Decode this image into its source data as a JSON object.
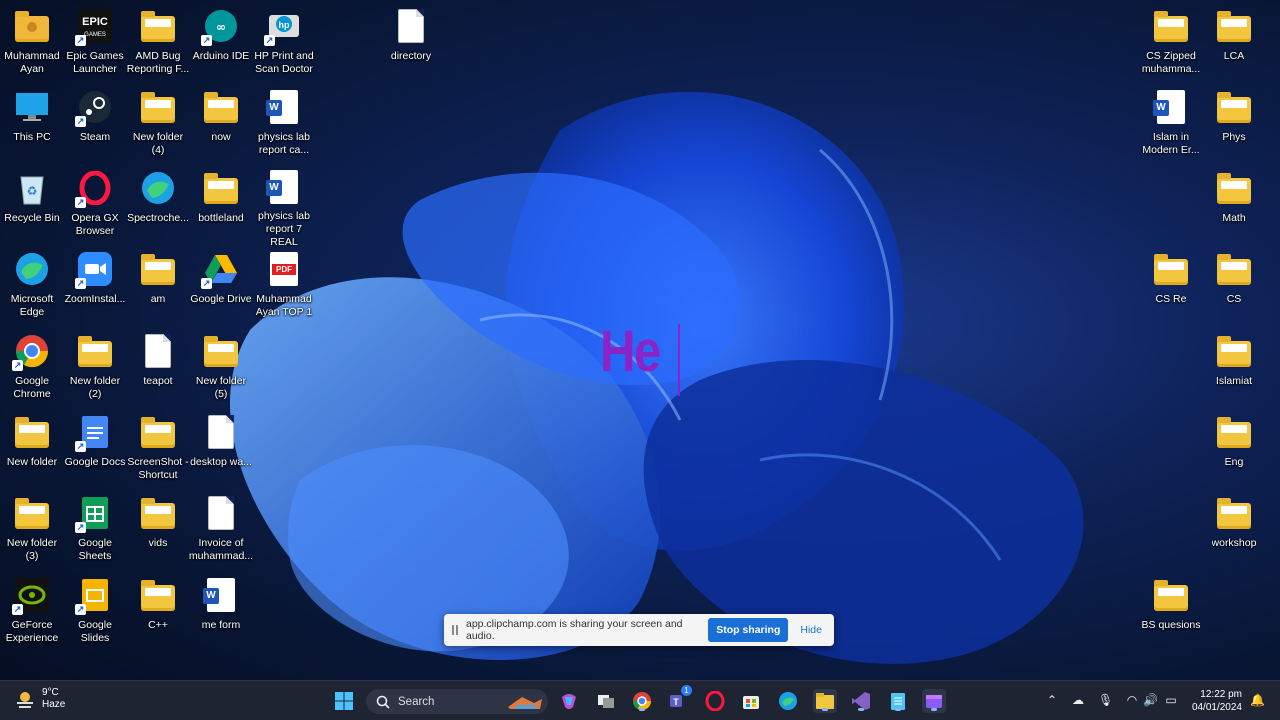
{
  "desktop": {
    "icons_left": [
      {
        "label": "Muhammad Ayan",
        "icon": "user-folder-icon"
      },
      {
        "label": "Epic Games Launcher",
        "icon": "epic-games-icon"
      },
      {
        "label": "AMD Bug Reporting F...",
        "icon": "folder-icon"
      },
      {
        "label": "Arduino IDE",
        "icon": "arduino-icon"
      },
      {
        "label": "HP Print and Scan Doctor",
        "icon": "hp-icon"
      },
      {
        "label": "directory",
        "icon": "text-file-icon"
      },
      {
        "label": "This PC",
        "icon": "monitor-icon"
      },
      {
        "label": "Steam",
        "icon": "steam-icon"
      },
      {
        "label": "New folder (4)",
        "icon": "folder-icon"
      },
      {
        "label": "now",
        "icon": "folder-icon"
      },
      {
        "label": "physics lab report ca...",
        "icon": "word-icon"
      },
      {
        "label": "Recycle Bin",
        "icon": "recycle-bin-icon"
      },
      {
        "label": "Opera GX Browser",
        "icon": "opera-gx-icon"
      },
      {
        "label": "Spectroche...",
        "icon": "edge-icon"
      },
      {
        "label": "bottleland",
        "icon": "folder-icon"
      },
      {
        "label": "physics lab report 7 REAL",
        "icon": "word-icon"
      },
      {
        "label": "Microsoft Edge",
        "icon": "edge-icon"
      },
      {
        "label": "ZoomInstal...",
        "icon": "zoom-icon"
      },
      {
        "label": "am",
        "icon": "folder-icon"
      },
      {
        "label": "Google Drive",
        "icon": "google-drive-icon"
      },
      {
        "label": "Muhammad Ayan TOP 1",
        "icon": "pdf-icon"
      },
      {
        "label": "Google Chrome",
        "icon": "chrome-icon"
      },
      {
        "label": "New folder (2)",
        "icon": "folder-icon"
      },
      {
        "label": "teapot",
        "icon": "text-file-icon"
      },
      {
        "label": "New folder (5)",
        "icon": "folder-icon"
      },
      {
        "label": "New folder",
        "icon": "folder-icon"
      },
      {
        "label": "Google Docs",
        "icon": "google-docs-icon"
      },
      {
        "label": "ScreenShot - Shortcut",
        "icon": "folder-icon"
      },
      {
        "label": "desktop wa...",
        "icon": "text-file-icon"
      },
      {
        "label": "New folder (3)",
        "icon": "folder-icon"
      },
      {
        "label": "Google Sheets",
        "icon": "google-sheets-icon"
      },
      {
        "label": "vids",
        "icon": "folder-icon"
      },
      {
        "label": "Invoice of muhammad...",
        "icon": "text-file-icon"
      },
      {
        "label": "GeForce Experience",
        "icon": "geforce-icon"
      },
      {
        "label": "Google Slides",
        "icon": "google-slides-icon"
      },
      {
        "label": "C++",
        "icon": "folder-icon"
      },
      {
        "label": "me form",
        "icon": "word-icon"
      }
    ],
    "icons_right": [
      {
        "label": "CS Zipped muhamma...",
        "icon": "zip-folder-icon"
      },
      {
        "label": "LCA",
        "icon": "folder-icon"
      },
      {
        "label": "Islam in Modern Er...",
        "icon": "word-icon"
      },
      {
        "label": "Phys",
        "icon": "folder-icon"
      },
      {
        "label": "Math",
        "icon": "folder-icon"
      },
      {
        "label": "CS Re",
        "icon": "folder-icon"
      },
      {
        "label": "CS",
        "icon": "folder-icon"
      },
      {
        "label": "Islamiat",
        "icon": "folder-icon"
      },
      {
        "label": "Eng",
        "icon": "folder-icon"
      },
      {
        "label": "workshop",
        "icon": "folder-icon"
      },
      {
        "label": "BS quesions",
        "icon": "folder-icon"
      }
    ]
  },
  "overlay": {
    "typed_text": "He"
  },
  "share_bar": {
    "message": "app.clipchamp.com is sharing your screen and audio.",
    "stop_label": "Stop sharing",
    "hide_label": "Hide"
  },
  "taskbar": {
    "weather_temp": "9°C",
    "weather_desc": "Haze",
    "search_label": "Search",
    "teams_badge": "1",
    "time": "12:22 pm",
    "date": "04/01/2024"
  },
  "colors": {
    "accent": "#1a6fd6",
    "overlay_text": "#8a24c8",
    "taskbar": "#1f2433"
  }
}
